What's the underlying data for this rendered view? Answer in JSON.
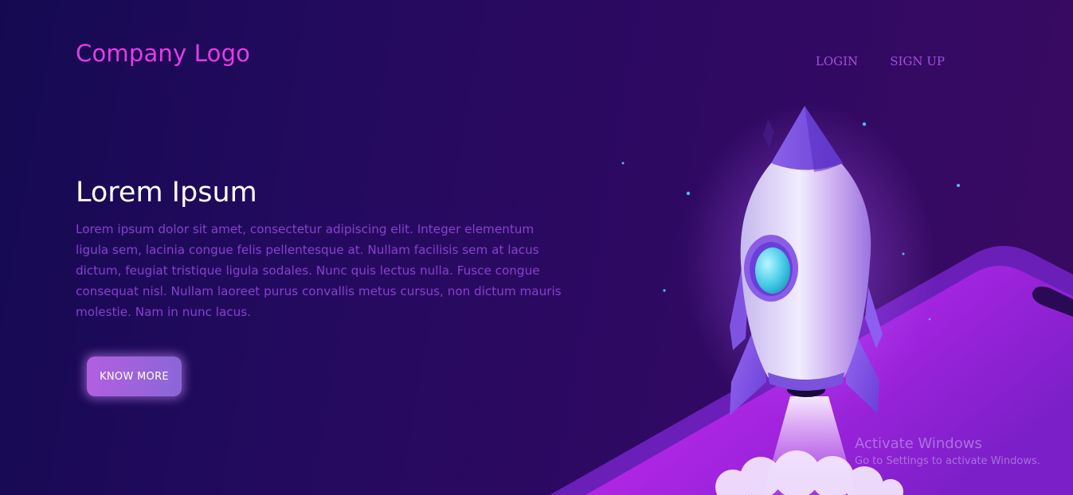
{
  "header": {
    "logo_text": "Company Logo",
    "nav": [
      {
        "label": "LOGIN"
      },
      {
        "label": "SIGN UP"
      }
    ]
  },
  "hero": {
    "title": "Lorem Ipsum",
    "body": "Lorem ipsum dolor sit amet, consectetur adipiscing elit. Integer elementum ligula sem, lacinia congue felis pellentesque at. Nullam facilisis sem at lacus dictum, feugiat tristique ligula sodales. Nunc quis lectus nulla. Fusce congue consequat nisl. Nullam laoreet purus convallis metus cursus, non dictum mauris molestie. Nam in nunc lacus.",
    "cta_label": "KNOW MORE"
  },
  "watermark": {
    "title": "Activate Windows",
    "subtitle": "Go to Settings to activate Windows."
  },
  "colors": {
    "logo": "#e63be3",
    "nav": "#a64ce6",
    "body_text": "#8a3fd0",
    "background": "#230a5e",
    "button_start": "#b15fe0",
    "button_end": "#8a67d6"
  }
}
